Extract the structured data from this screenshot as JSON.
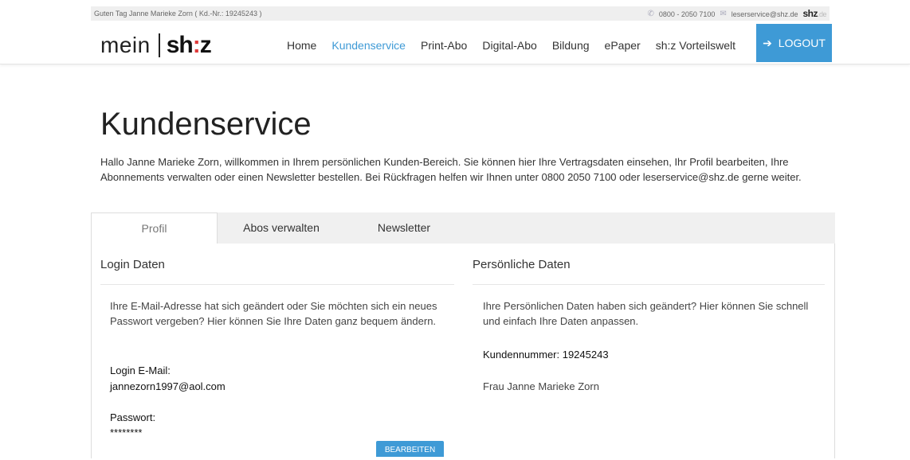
{
  "topbar": {
    "greeting": "Guten Tag Janne Marieke Zorn ( Kd.-Nr.: 19245243 )",
    "phone": "0800 - 2050 7100",
    "email": "leserservice@shz.de",
    "brand": "shz",
    "brand_tld": ".de"
  },
  "logo": {
    "mein": "mein",
    "shz_a": "sh",
    "shz_colon": ":",
    "shz_b": "z"
  },
  "nav": {
    "items": [
      "Home",
      "Kundenservice",
      "Print-Abo",
      "Digital-Abo",
      "Bildung",
      "ePaper",
      "sh:z Vorteilswelt"
    ],
    "active_index": 1,
    "logout_label": "LOGOUT"
  },
  "page": {
    "title": "Kundenservice",
    "intro": "Hallo Janne Marieke Zorn, willkommen in Ihrem persönlichen Kunden-Bereich. Sie können hier Ihre Vertragsdaten einsehen, Ihr Profil bearbeiten, Ihre Abonnements verwalten oder einen Newsletter bestellen. Bei Rückfragen helfen wir Ihnen unter 0800 2050 7100 oder leserservice@shz.de gerne weiter."
  },
  "tabs": [
    "Profil",
    "Abos verwalten",
    "Newsletter"
  ],
  "login": {
    "heading": "Login Daten",
    "text": "Ihre E-Mail-Adresse hat sich geändert oder Sie möchten sich ein neues Passwort vergeben? Hier können Sie Ihre Daten ganz bequem ändern.",
    "email_label": "Login E-Mail:",
    "email_value": "jannezorn1997@aol.com",
    "password_label": "Passwort:",
    "password_value": "********",
    "edit_label": "BEARBEITEN"
  },
  "personal": {
    "heading": "Persönliche Daten",
    "text": "Ihre Persönlichen Daten haben sich geändert? Hier können Sie schnell und einfach Ihre Daten anpassen.",
    "customer_number": "Kundennummer: 19245243",
    "name": "Frau Janne Marieke Zorn"
  },
  "colors": {
    "accent": "#3e9ad6",
    "brand_red": "#e03a3a"
  }
}
